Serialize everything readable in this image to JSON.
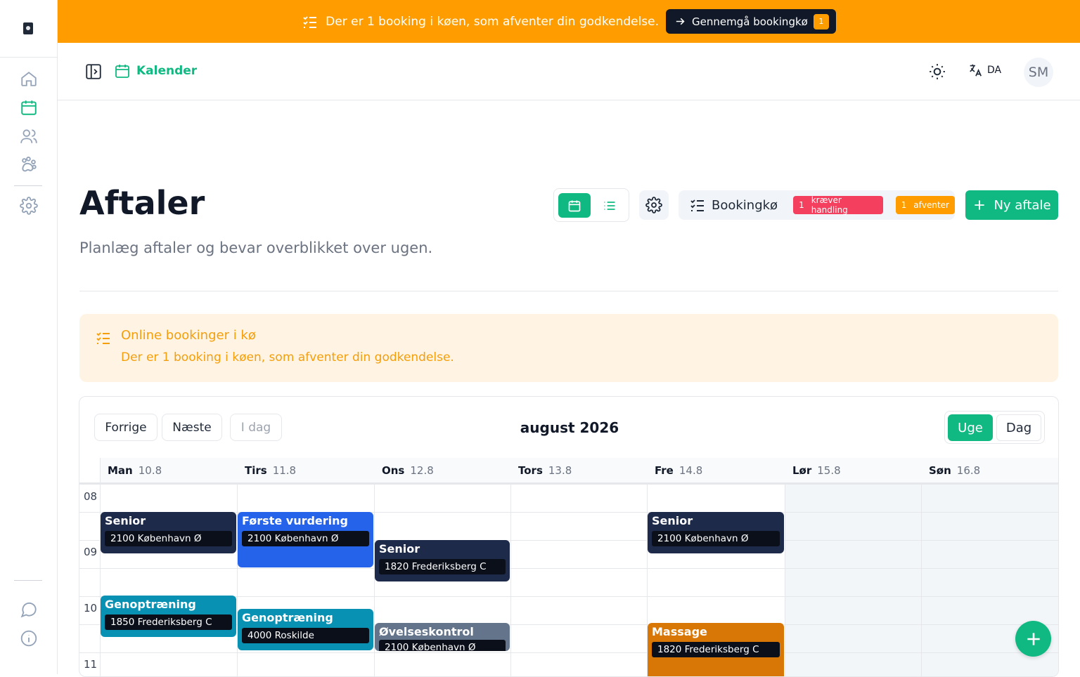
{
  "banner": {
    "text": "Der er 1 booking i køen, som afventer din godkendelse.",
    "button_label": "Gennemgå bookingkø",
    "badge": "1"
  },
  "topbar": {
    "breadcrumb": "Kalender",
    "language": "DA",
    "avatar_initials": "SM"
  },
  "page": {
    "title": "Aftaler",
    "subtitle": "Planlæg aftaler og bevar overblikket over ugen."
  },
  "toolbar": {
    "queue_label": "Bookingkø",
    "requires_action_count": "1",
    "requires_action_label": "kræver handling",
    "pending_count": "1",
    "pending_label": "afventer",
    "new_label": "Ny aftale"
  },
  "alert": {
    "title": "Online bookinger i kø",
    "description": "Der er 1 booking i køen, som afventer din godkendelse."
  },
  "calendar": {
    "prev_label": "Forrige",
    "next_label": "Næste",
    "today_label": "I dag",
    "month_label": "august 2026",
    "week_label": "Uge",
    "day_label": "Dag",
    "days": [
      {
        "name": "Man",
        "date": "10.8"
      },
      {
        "name": "Tirs",
        "date": "11.8"
      },
      {
        "name": "Ons",
        "date": "12.8"
      },
      {
        "name": "Tors",
        "date": "13.8"
      },
      {
        "name": "Fre",
        "date": "14.8"
      },
      {
        "name": "Lør",
        "date": "15.8"
      },
      {
        "name": "Søn",
        "date": "16.8"
      }
    ],
    "hours": [
      "08",
      "09",
      "10",
      "11"
    ],
    "events": [
      {
        "title": "Senior",
        "place": "2100 København Ø",
        "color": "#1e2a4a"
      },
      {
        "title": "Første vurdering",
        "place": "2100 København Ø",
        "color": "#2563eb"
      },
      {
        "title": "Senior",
        "place": "1820 Frederiksberg C",
        "color": "#1e2a4a"
      },
      {
        "title": "Senior",
        "place": "2100 København Ø",
        "color": "#1e2a4a"
      },
      {
        "title": "Genoptræning",
        "place": "1850 Frederiksberg C",
        "color": "#0891b2"
      },
      {
        "title": "Genoptræning",
        "place": "4000 Roskilde",
        "color": "#0891b2"
      },
      {
        "title": "Øvelseskontrol",
        "place": "2100 København Ø",
        "color": "#64748b"
      },
      {
        "title": "Massage",
        "place": "1820 Frederiksberg C",
        "color": "#d97706"
      }
    ]
  },
  "colors": {
    "accent": "#10b981",
    "warning": "#ff9d00",
    "danger": "#f43f5e"
  }
}
